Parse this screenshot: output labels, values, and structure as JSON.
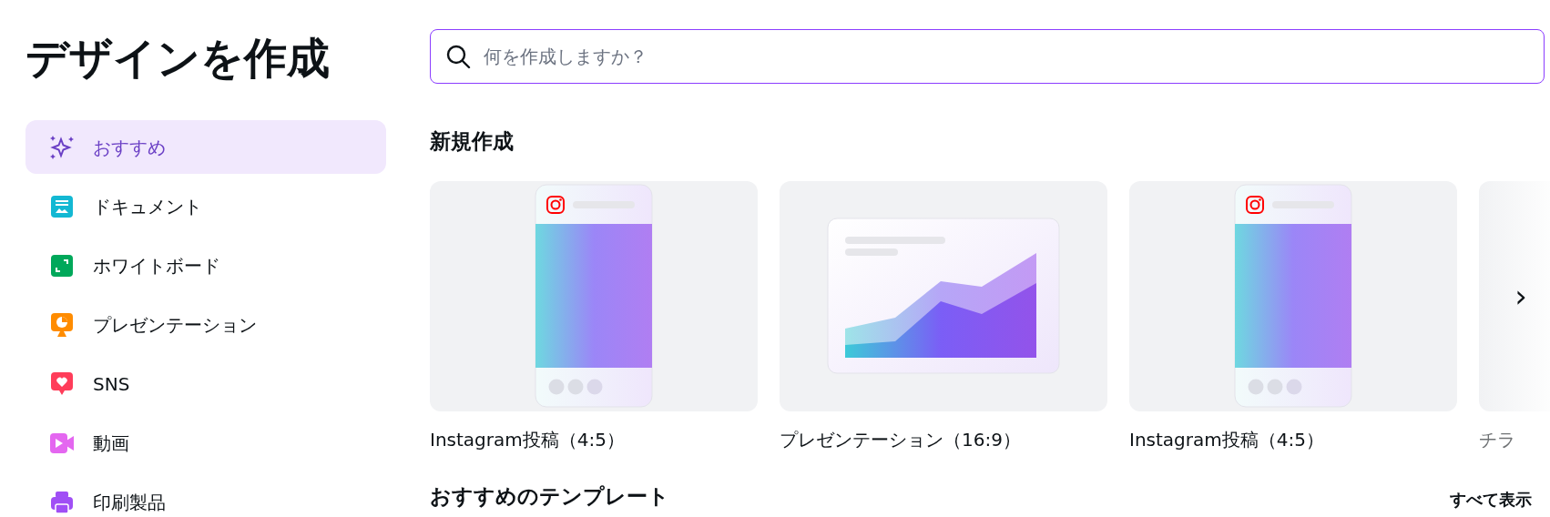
{
  "title": "デザインを作成",
  "sidebar": {
    "items": [
      {
        "label": "おすすめ",
        "selected": true,
        "color": "#6a3fc5"
      },
      {
        "label": "ドキュメント",
        "selected": false,
        "color": "#13b8d3"
      },
      {
        "label": "ホワイトボード",
        "selected": false,
        "color": "#00a85a"
      },
      {
        "label": "プレゼンテーション",
        "selected": false,
        "color": "#ff8c00"
      },
      {
        "label": "SNS",
        "selected": false,
        "color": "#ff3d5a"
      },
      {
        "label": "動画",
        "selected": false,
        "color": "#e467f0"
      },
      {
        "label": "印刷製品",
        "selected": false,
        "color": "#a04ff5"
      }
    ]
  },
  "search": {
    "placeholder": "何を作成しますか？"
  },
  "new_section": {
    "heading": "新規作成",
    "cards": [
      {
        "kind": "instagram",
        "label": "Instagram投稿（4:5）"
      },
      {
        "kind": "presentation",
        "label": "プレゼンテーション（16:9）"
      },
      {
        "kind": "instagram",
        "label": "Instagram投稿（4:5）"
      },
      {
        "kind": "faded",
        "label": "チラ"
      }
    ],
    "next_button": "›"
  },
  "templates_section": {
    "heading": "おすすめのテンプレート",
    "link": "すべて表示"
  }
}
